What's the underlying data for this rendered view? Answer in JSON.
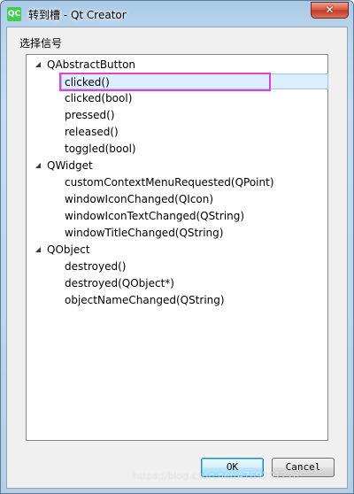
{
  "window": {
    "app_icon_text": "QC",
    "title": "转到槽 - Qt Creator",
    "close_glyph": "✕"
  },
  "group": {
    "label": "选择信号"
  },
  "tree": [
    {
      "label": "QAbstractButton",
      "children": [
        "clicked()",
        "clicked(bool)",
        "pressed()",
        "released()",
        "toggled(bool)"
      ]
    },
    {
      "label": "QWidget",
      "children": [
        "customContextMenuRequested(QPoint)",
        "windowIconChanged(QIcon)",
        "windowIconTextChanged(QString)",
        "windowTitleChanged(QString)"
      ]
    },
    {
      "label": "QObject",
      "children": [
        "destroyed()",
        "destroyed(QObject*)",
        "objectNameChanged(QString)"
      ]
    }
  ],
  "selected": "clicked()",
  "buttons": {
    "ok": "OK",
    "cancel": "Cancel"
  },
  "watermark": "https://blog.csdn.net/A769201228",
  "colors": {
    "highlight_outline": "#e040d8",
    "selection": "#ddeeff"
  }
}
